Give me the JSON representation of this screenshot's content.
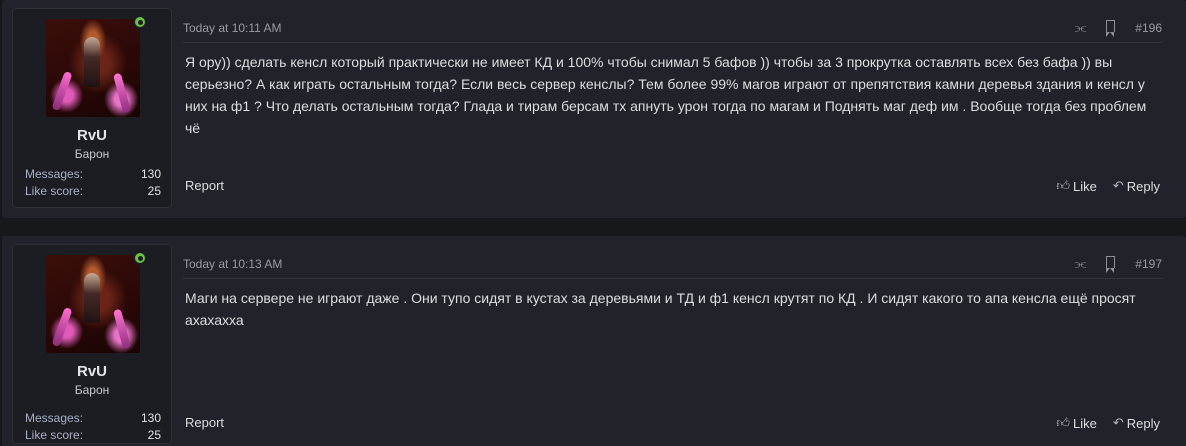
{
  "posts": [
    {
      "user": {
        "name": "RvU",
        "title": "Барон",
        "messages_label": "Messages:",
        "messages": "130",
        "like_label": "Like score:",
        "likes": "25"
      },
      "time": "Today at 10:11 AM",
      "number": "#196",
      "text": "Я ору)) сделать кенсл который практически не имеет КД и 100% чтобы снимал 5 бафов )) чтобы за 3 прокрутка оставлять всех без бафа )) вы серьезно? А как играть остальным тогда? Если весь сервер кенслы? Тем более 99% магов играют от препятствия камни деревья здания и кенсл у них на ф1 ? Что делать остальным тогда? Глада и тирам берсам тх апнуть урон тогда по магам и Поднять маг деф им . Вообще тогда без проблем чё",
      "report": "Report",
      "like": "Like",
      "reply": "Reply"
    },
    {
      "user": {
        "name": "RvU",
        "title": "Барон",
        "messages_label": "Messages:",
        "messages": "130",
        "like_label": "Like score:",
        "likes": "25"
      },
      "time": "Today at 10:13 AM",
      "number": "#197",
      "text": "Маги на сервере не играют даже . Они тупо сидят в кустах за деревьями и ТД и ф1 кенсл крутят по КД . И сидят какого то апа кенсла ещё просят ахахахха",
      "report": "Report",
      "like": "Like",
      "reply": "Reply"
    }
  ],
  "icons": {
    "share": "share-icon",
    "bookmark": "bookmark-icon",
    "like": "thumbs-up-icon",
    "reply": "reply-arrow-icon",
    "online": "online-status-icon"
  },
  "colors": {
    "background": "#17181c",
    "post": "#22232a",
    "online": "#6ac144",
    "stat_label": "#a9b0c6"
  }
}
